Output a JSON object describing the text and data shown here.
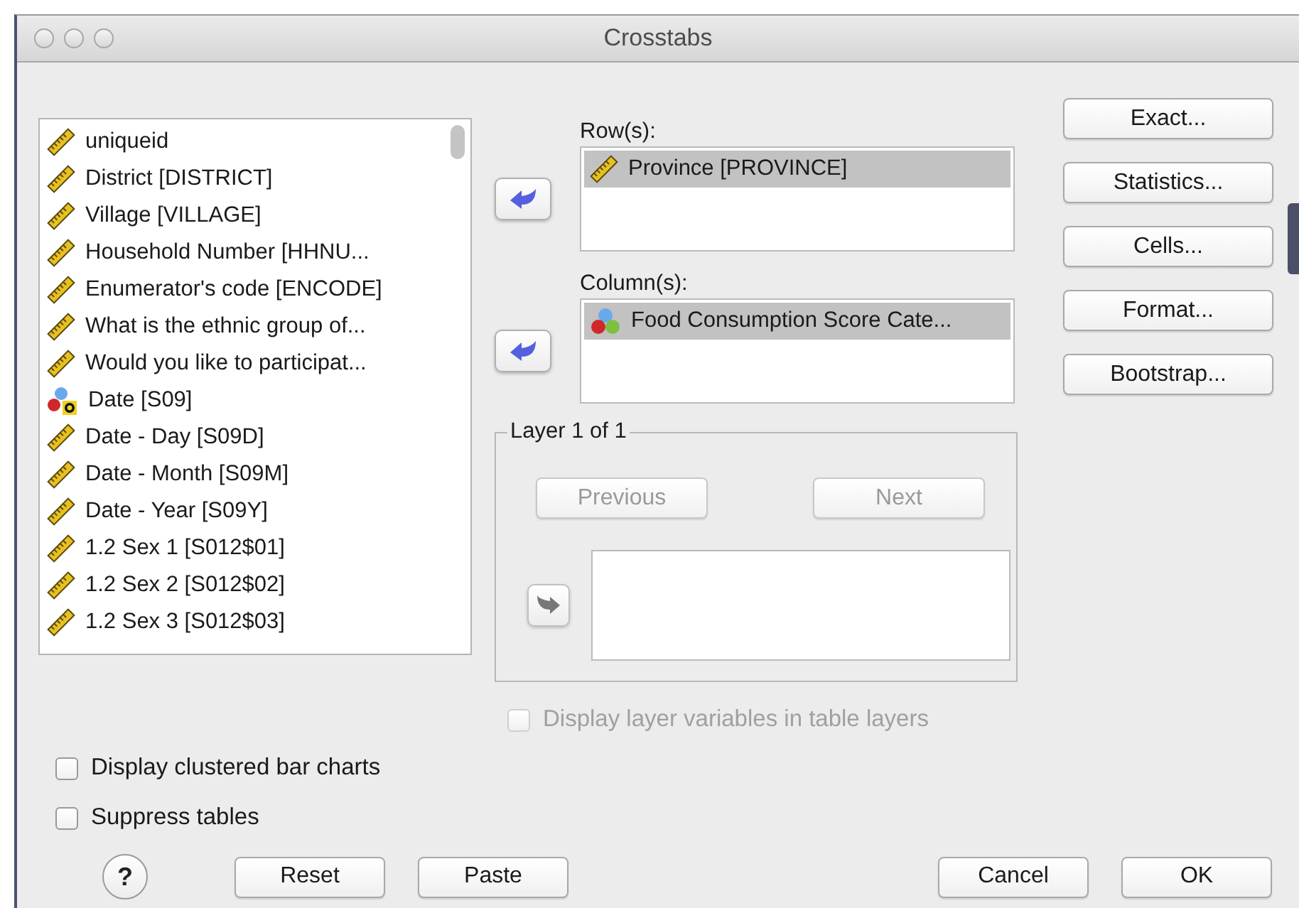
{
  "window": {
    "title": "Crosstabs"
  },
  "variables": [
    {
      "kind": "scale",
      "label": "uniqueid"
    },
    {
      "kind": "scale",
      "label": "District [DISTRICT]"
    },
    {
      "kind": "scale",
      "label": "Village [VILLAGE]"
    },
    {
      "kind": "scale",
      "label": "Household Number [HHNU..."
    },
    {
      "kind": "scale",
      "label": "Enumerator's code [ENCODE]"
    },
    {
      "kind": "scale",
      "label": "What is the ethnic group of..."
    },
    {
      "kind": "scale",
      "label": "Would you like to participat..."
    },
    {
      "kind": "string",
      "label": "Date [S09]"
    },
    {
      "kind": "scale",
      "label": "Date - Day [S09D]"
    },
    {
      "kind": "scale",
      "label": "Date - Month [S09M]"
    },
    {
      "kind": "scale",
      "label": "Date - Year [S09Y]"
    },
    {
      "kind": "scale",
      "label": "1.2 Sex 1 [S012$01]"
    },
    {
      "kind": "scale",
      "label": "1.2 Sex 2 [S012$02]"
    },
    {
      "kind": "scale",
      "label": "1.2 Sex 3 [S012$03]"
    }
  ],
  "rows": {
    "label": "Row(s):",
    "items": [
      {
        "kind": "scale",
        "label": "Province [PROVINCE]",
        "selected": true
      }
    ]
  },
  "columns": {
    "label": "Column(s):",
    "items": [
      {
        "kind": "nominal",
        "label": "Food Consumption Score Cate...",
        "selected": true
      }
    ]
  },
  "layer": {
    "label": "Layer 1 of 1",
    "previous": {
      "label": "Previous",
      "disabled": true
    },
    "next": {
      "label": "Next",
      "disabled": true
    }
  },
  "side_buttons": [
    "Exact...",
    "Statistics...",
    "Cells...",
    "Format...",
    "Bootstrap..."
  ],
  "options": [
    {
      "label": "Display layer variables in table layers",
      "checked": false,
      "disabled": true
    },
    {
      "label": "Display clustered bar charts",
      "checked": false,
      "disabled": false
    },
    {
      "label": "Suppress tables",
      "checked": false,
      "disabled": false
    }
  ],
  "help": "?",
  "buttons": [
    "Reset",
    "Paste",
    "Cancel",
    "OK"
  ]
}
